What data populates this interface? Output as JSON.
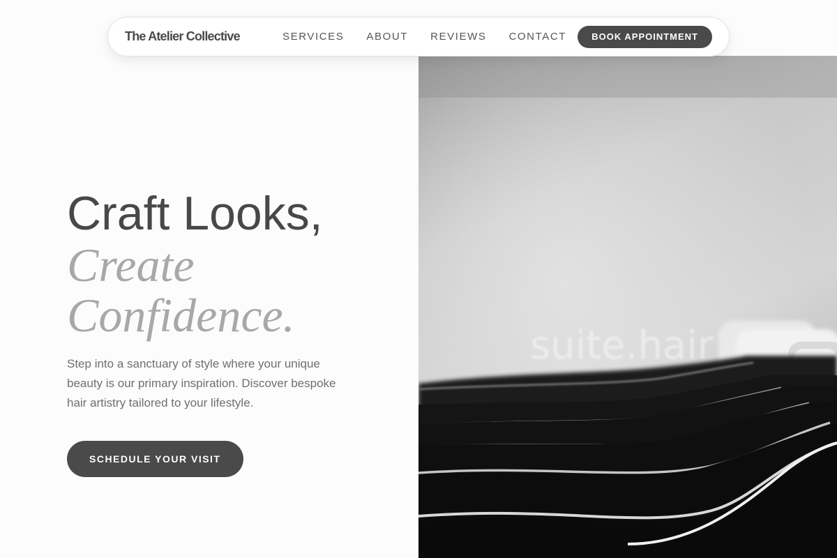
{
  "nav": {
    "brand": "The Atelier Collective",
    "links": [
      "SERVICES",
      "ABOUT",
      "REVIEWS",
      "CONTACT"
    ],
    "cta": "BOOK APPOINTMENT"
  },
  "hero": {
    "headline_line1": "Craft Looks,",
    "headline_line2": "Create",
    "headline_line3": "Confidence.",
    "description": "Step into a sanctuary of style where your unique beauty is our primary inspiration. Discover bespoke hair artistry tailored to your lifestyle.",
    "cta": "SCHEDULE YOUR VISIT",
    "image_watermark": "suite.hair"
  },
  "colors": {
    "button_bg": "#4a4a4a",
    "headline": "#484848",
    "headline_accent": "#a8a8a8",
    "body_text": "#6f6f6f"
  }
}
